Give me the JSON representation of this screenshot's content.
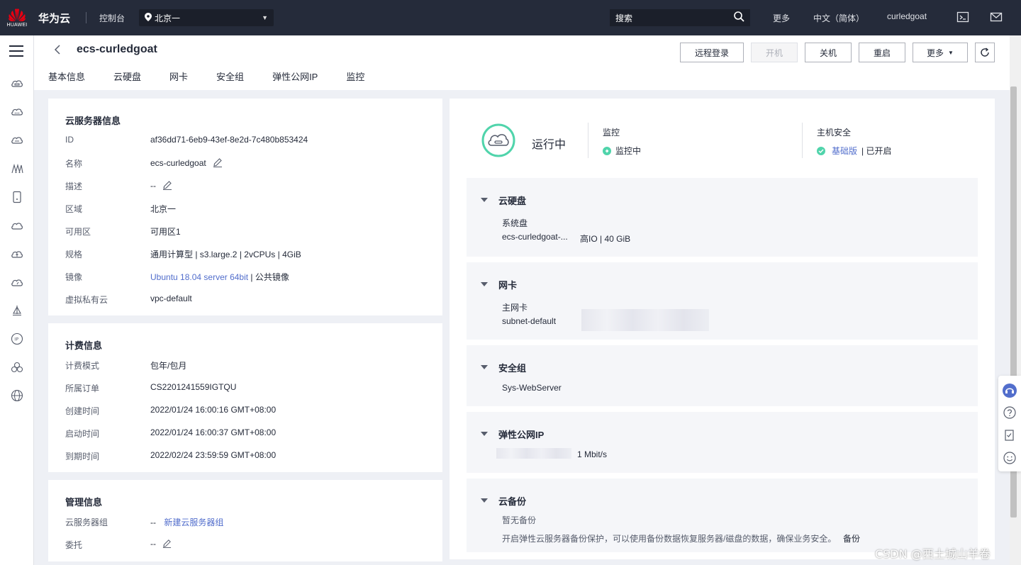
{
  "topbar": {
    "logo_text": "HUAWEI",
    "brand": "华为云",
    "console": "控制台",
    "region": "北京一",
    "search_placeholder": "搜索",
    "more": "更多",
    "language": "中文（简体）",
    "user": "curledgoat"
  },
  "header": {
    "title": "ecs-curledgoat",
    "buttons": {
      "remote_login": "远程登录",
      "power_on": "开机",
      "shutdown": "关机",
      "restart": "重启",
      "more": "更多"
    },
    "tabs": [
      "基本信息",
      "云硬盘",
      "网卡",
      "安全组",
      "弹性公网IP",
      "监控"
    ]
  },
  "server_info": {
    "title": "云服务器信息",
    "rows": [
      {
        "label": "ID",
        "value": "af36dd71-6eb9-43ef-8e2d-7c480b853424"
      },
      {
        "label": "名称",
        "value": "ecs-curledgoat"
      },
      {
        "label": "描述",
        "value": "--"
      },
      {
        "label": "区域",
        "value": "北京一"
      },
      {
        "label": "可用区",
        "value": "可用区1"
      },
      {
        "label": "规格",
        "value": "通用计算型 | s3.large.2 | 2vCPUs | 4GiB"
      },
      {
        "label": "镜像",
        "value_link": "Ubuntu 18.04 server 64bit",
        "value_suffix": " | 公共镜像"
      },
      {
        "label": "虚拟私有云",
        "value_link": "vpc-default"
      }
    ]
  },
  "billing_info": {
    "title": "计费信息",
    "rows": [
      {
        "label": "计费模式",
        "value": "包年/包月"
      },
      {
        "label": "所属订单",
        "value_link": "CS2201241559IGTQU"
      },
      {
        "label": "创建时间",
        "value": "2022/01/24 16:00:16 GMT+08:00"
      },
      {
        "label": "启动时间",
        "value": "2022/01/24 16:00:37 GMT+08:00"
      },
      {
        "label": "到期时间",
        "value": "2022/02/24 23:59:59 GMT+08:00"
      }
    ]
  },
  "management_info": {
    "title": "管理信息",
    "rows": [
      {
        "label": "云服务器组",
        "value": "--",
        "value_link": "新建云服务器组"
      },
      {
        "label": "委托",
        "value": "--"
      }
    ]
  },
  "status": {
    "state": "运行中",
    "monitor_label": "监控",
    "monitor_value": "监控中",
    "security_label": "主机安全",
    "security_link": "基础版",
    "security_value": "| 已开启"
  },
  "sections": {
    "disk": {
      "title": "云硬盘",
      "sub": "系统盘",
      "disk_link": "ecs-curledgoat-...",
      "disk_info": "高IO  |  40 GiB"
    },
    "nic": {
      "title": "网卡",
      "sub": "主网卡",
      "subnet": "subnet-default"
    },
    "security_group": {
      "title": "安全组",
      "link": "Sys-WebServer"
    },
    "eip": {
      "title": "弹性公网IP",
      "bandwidth": "1 Mbit/s"
    },
    "backup": {
      "title": "云备份",
      "empty": "暂无备份",
      "hint": "开启弹性云服务器备份保护，可以使用备份数据恢复服务器/磁盘的数据，确保业务安全。",
      "backup_link": "备份"
    }
  },
  "watermark": "CSDN @西土城山羊卷",
  "colors": {
    "topbar": "#252b3a",
    "link": "#526ecc",
    "running": "#50d4ab"
  }
}
